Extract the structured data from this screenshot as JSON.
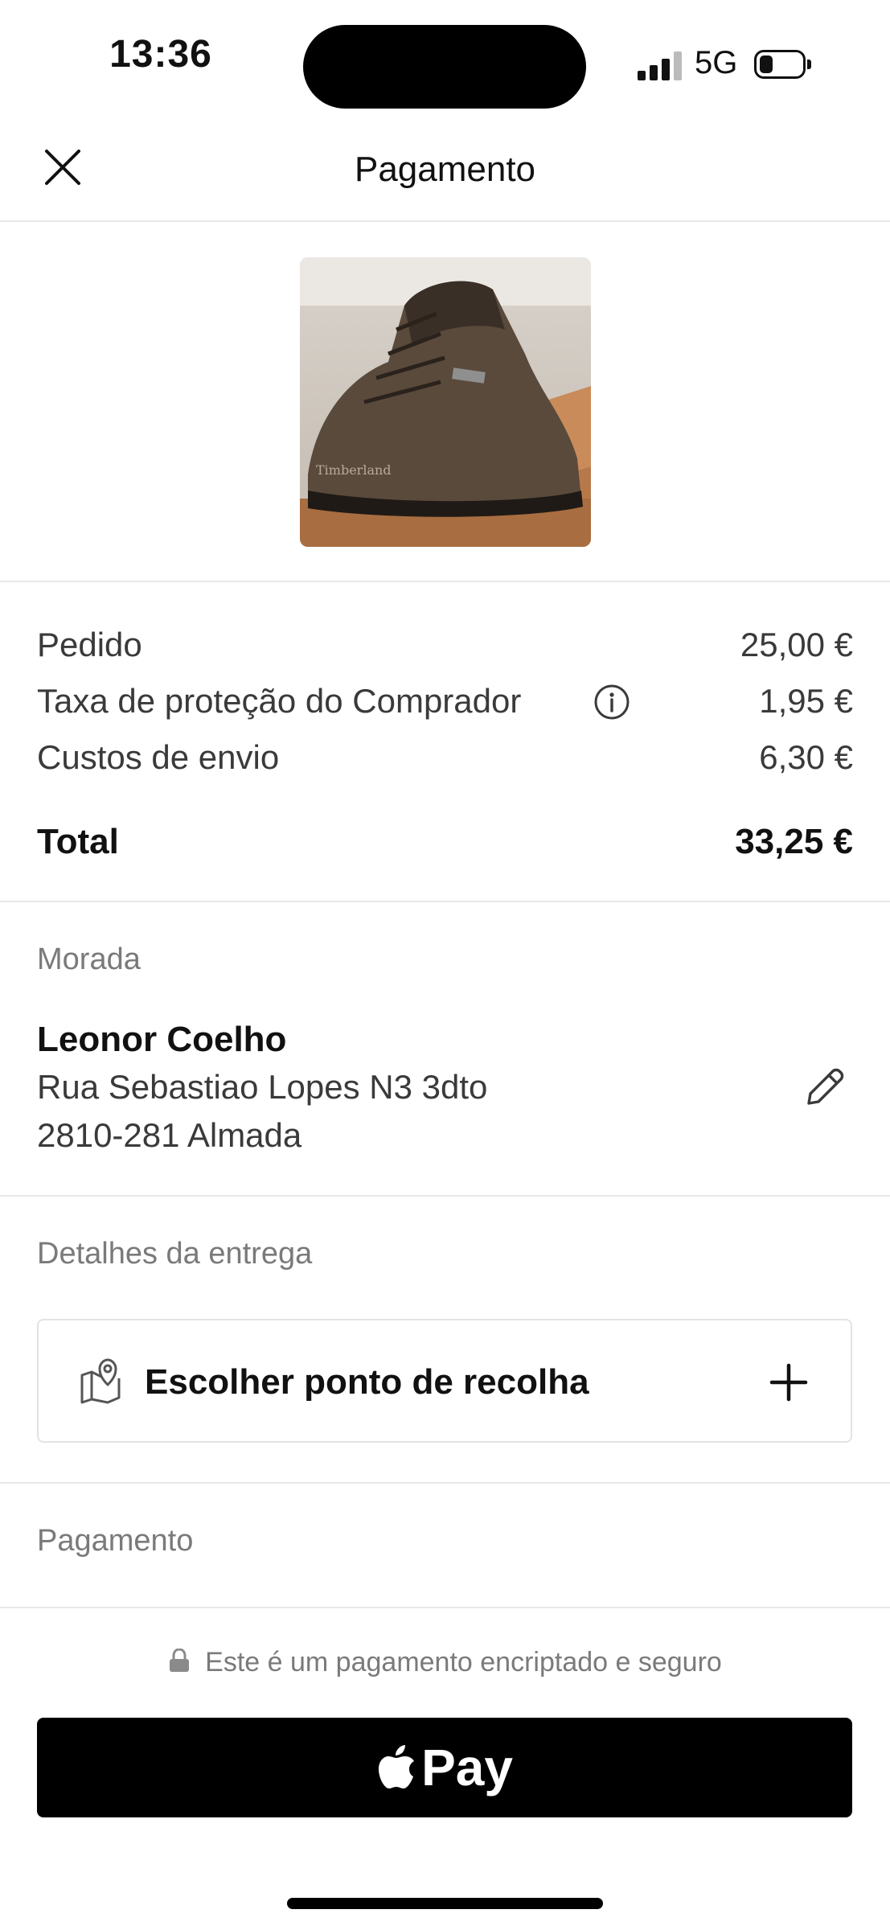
{
  "status_bar": {
    "time": "13:36",
    "network": "5G"
  },
  "header": {
    "title": "Pagamento",
    "close_icon": "close-icon"
  },
  "product": {
    "image_alt": "Timberland"
  },
  "summary": {
    "rows": [
      {
        "label": "Pedido",
        "value": "25,00 €"
      },
      {
        "label": "Taxa de proteção do Comprador",
        "value": "1,95 €",
        "icon": "info-icon"
      },
      {
        "label": "Custos de envio",
        "value": "6,30 €"
      }
    ],
    "total_label": "Total",
    "total_value": "33,25 €"
  },
  "address": {
    "section_label": "Morada",
    "name": "Leonor Coelho",
    "line1": "Rua Sebastiao Lopes N3 3dto",
    "line2": "2810-281 Almada",
    "edit_icon": "pencil-icon"
  },
  "delivery": {
    "section_label": "Detalhes da entrega",
    "pickup_label": "Escolher ponto de recolha",
    "pickup_icon": "map-pin-icon",
    "add_icon": "plus-icon"
  },
  "payment": {
    "section_label": "Pagamento",
    "secure_text": "Este é um pagamento encriptado e seguro",
    "button_text": "Pay"
  },
  "colors": {
    "primary_text": "#111111",
    "secondary_text": "#3a3a3a",
    "muted_text": "#7a7a7a",
    "divider": "#e8e8e8",
    "pay_button": "#000000"
  }
}
